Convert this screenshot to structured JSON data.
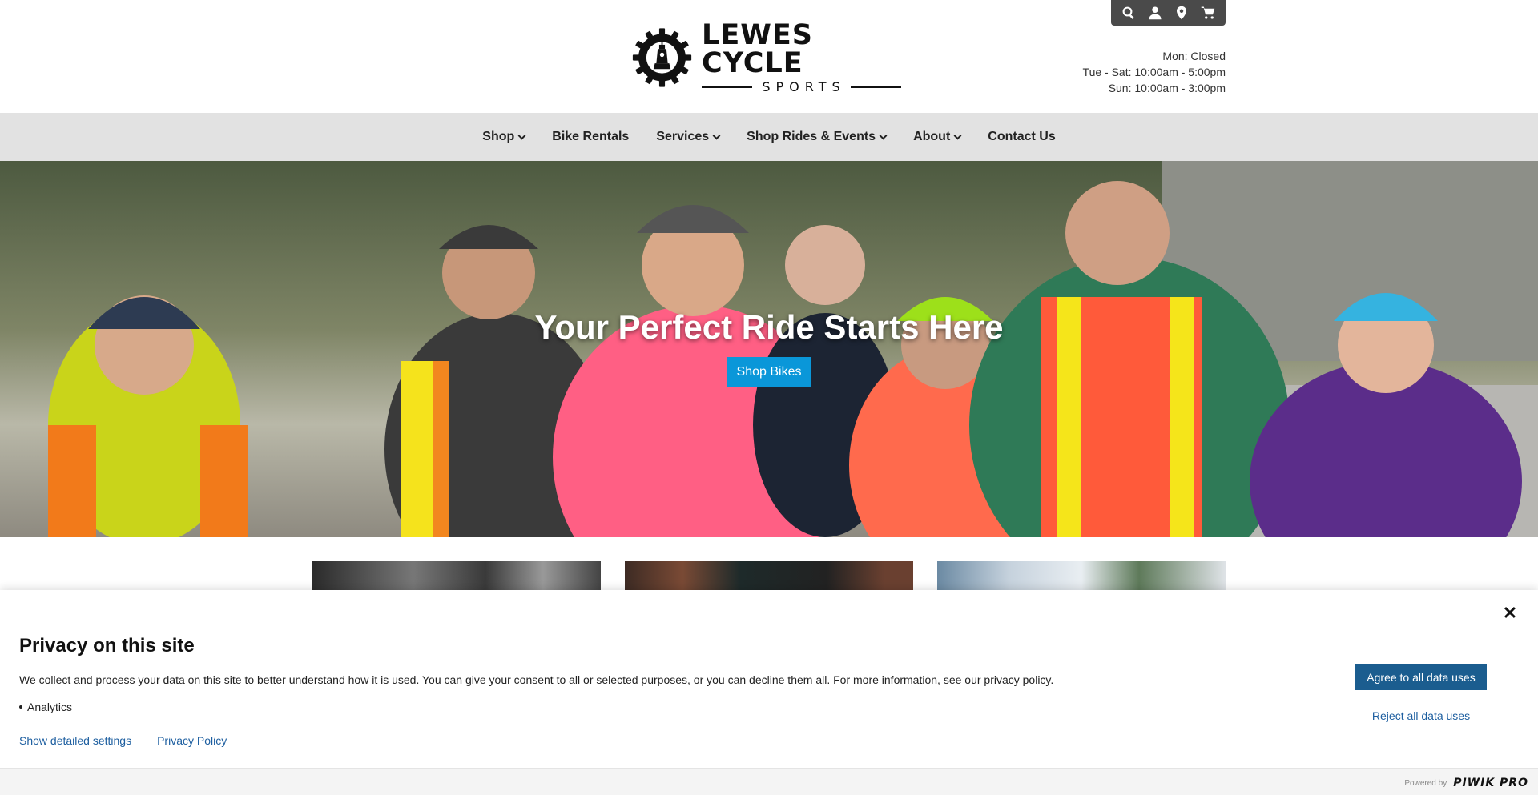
{
  "header": {
    "logo_main": "LEWES CYCLE",
    "logo_sub": "SPORTS",
    "utility_icons": [
      "search-icon",
      "user-icon",
      "location-icon",
      "cart-icon"
    ],
    "hours": [
      "Mon: Closed",
      "Tue - Sat: 10:00am - 5:00pm",
      "Sun: 10:00am - 3:00pm"
    ]
  },
  "nav": {
    "items": [
      {
        "label": "Shop",
        "dropdown": true
      },
      {
        "label": "Bike Rentals",
        "dropdown": false
      },
      {
        "label": "Services",
        "dropdown": true
      },
      {
        "label": "Shop Rides & Events",
        "dropdown": true
      },
      {
        "label": "About",
        "dropdown": true
      },
      {
        "label": "Contact Us",
        "dropdown": false
      }
    ]
  },
  "hero": {
    "title": "Your Perfect Ride Starts Here",
    "button_label": "Shop Bikes",
    "accent_color": "#0a97d9"
  },
  "privacy": {
    "title": "Privacy on this site",
    "text": "We collect and process your data on this site to better understand how it is used. You can give your consent to all or selected purposes, or you can decline them all. For more information, see our privacy policy.",
    "purposes": [
      "Analytics"
    ],
    "link_settings": "Show detailed settings",
    "link_policy": "Privacy Policy",
    "agree_label": "Agree to all data uses",
    "reject_label": "Reject all data uses",
    "close_icon": "close-icon",
    "powered_by": "Powered by",
    "brand": "PIWIK PRO",
    "agree_color": "#1b5d8f"
  }
}
